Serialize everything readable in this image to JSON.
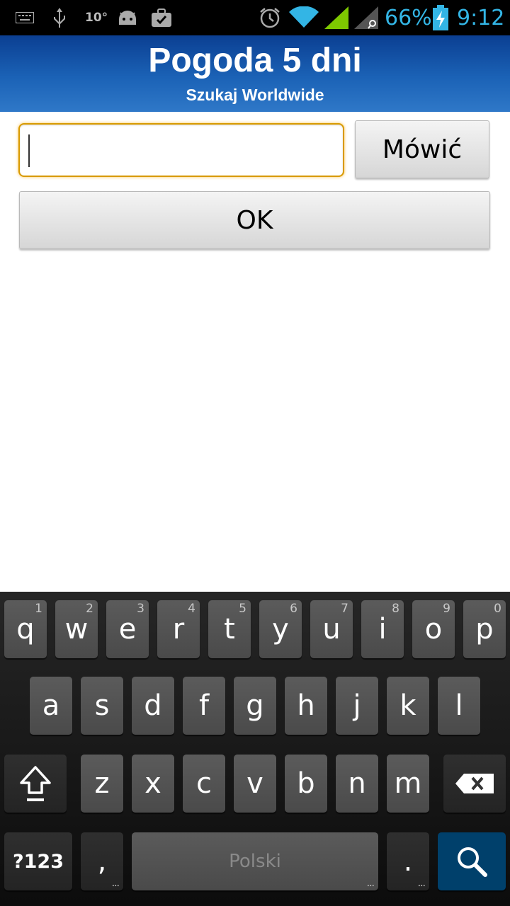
{
  "status_bar": {
    "temperature": "10°",
    "battery_percent": "66%",
    "time": "9:12",
    "icons": [
      "keyboard-icon",
      "usb-icon",
      "android-icon",
      "briefcase-check-icon",
      "alarm-icon",
      "wifi-icon",
      "signal-icon",
      "signal-roaming-icon",
      "battery-charging-icon"
    ],
    "accent_color": "#33b5e5"
  },
  "header": {
    "title": "Pogoda 5 dni",
    "subtitle": "Szukaj Worldwide"
  },
  "form": {
    "search_value": "",
    "speak_label": "Mówić",
    "ok_label": "OK"
  },
  "keyboard": {
    "row1": [
      {
        "k": "q",
        "h": "1"
      },
      {
        "k": "w",
        "h": "2"
      },
      {
        "k": "e",
        "h": "3"
      },
      {
        "k": "r",
        "h": "4"
      },
      {
        "k": "t",
        "h": "5"
      },
      {
        "k": "y",
        "h": "6"
      },
      {
        "k": "u",
        "h": "7"
      },
      {
        "k": "i",
        "h": "8"
      },
      {
        "k": "o",
        "h": "9"
      },
      {
        "k": "p",
        "h": "0"
      }
    ],
    "row2": [
      "a",
      "s",
      "d",
      "f",
      "g",
      "h",
      "j",
      "k",
      "l"
    ],
    "row3": [
      "z",
      "x",
      "c",
      "v",
      "b",
      "n",
      "m"
    ],
    "symbols_label": "?123",
    "comma": ",",
    "space_label": "Polski",
    "period": ".",
    "search_key_color": "#00406b"
  }
}
